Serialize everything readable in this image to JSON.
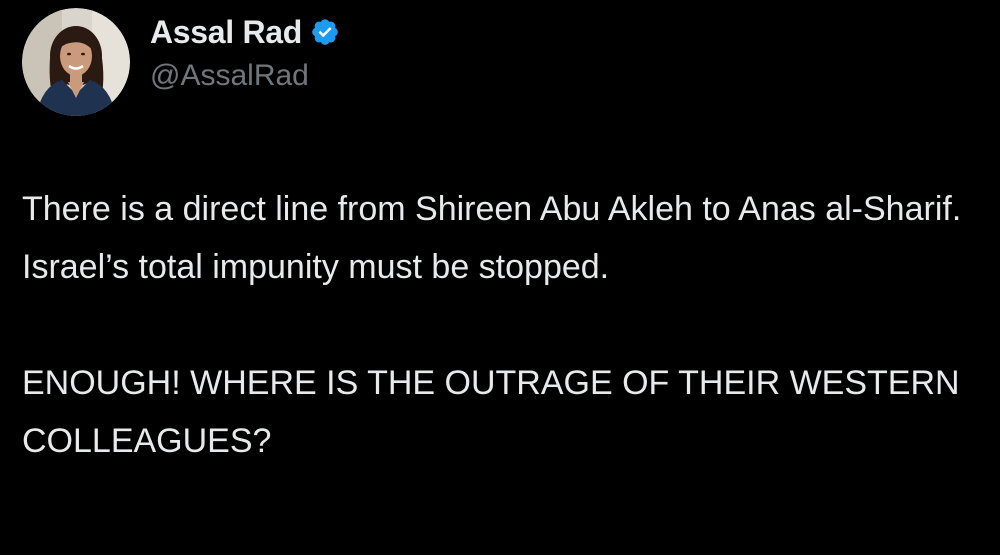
{
  "author": {
    "display_name": "Assal Rad",
    "handle": "@AssalRad",
    "verified": true,
    "avatar_icon": "profile-photo",
    "verified_icon": "verified-badge-icon"
  },
  "tweet": {
    "paragraphs": [
      "There is a direct line from Shireen Abu Akleh to Anas al-Sharif. Israel’s total impunity must be stopped.",
      "ENOUGH! WHERE IS THE OUTRAGE OF THEIR WESTERN COLLEAGUES?"
    ]
  },
  "colors": {
    "background": "#000000",
    "text": "#e7e9ea",
    "secondary_text": "#71767b",
    "verified_blue": "#1d9bf0"
  }
}
